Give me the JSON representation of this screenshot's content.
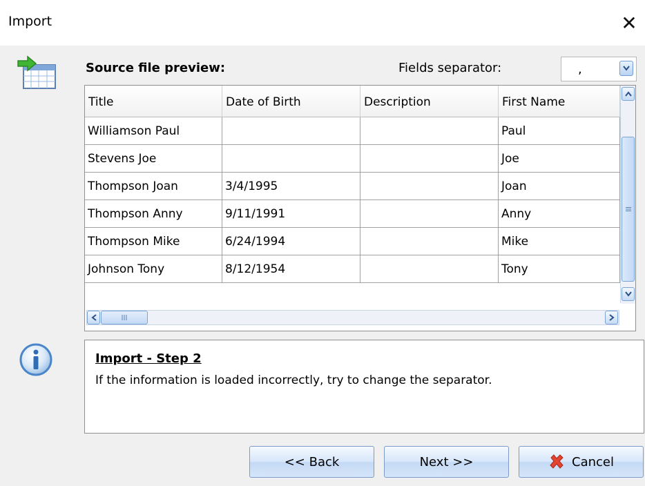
{
  "window": {
    "title": "Import",
    "close_glyph": "✕"
  },
  "header": {
    "preview_label": "Source file preview:",
    "separator_label": "Fields separator:",
    "separator_value": ","
  },
  "grid": {
    "columns": [
      "Title",
      "Date of Birth",
      "Description",
      "First Name"
    ],
    "rows": [
      [
        "Williamson Paul",
        "",
        "",
        "Paul"
      ],
      [
        "Stevens Joe",
        "",
        "",
        "Joe"
      ],
      [
        "Thompson Joan",
        "3/4/1995",
        "",
        "Joan"
      ],
      [
        "Thompson Anny",
        "9/11/1991",
        "",
        "Anny"
      ],
      [
        "Thompson Mike",
        "6/24/1994",
        "",
        "Mike"
      ],
      [
        "Johnson Tony",
        "8/12/1954",
        "",
        "Tony"
      ]
    ]
  },
  "info": {
    "title": "Import - Step 2",
    "text": "If the information is loaded incorrectly, try to change the separator."
  },
  "buttons": {
    "back": "<< Back",
    "next": "Next >>",
    "cancel": "Cancel"
  },
  "icons": {
    "import": "import-table-icon",
    "info": "info-icon",
    "cancel": "cancel-x-icon"
  },
  "colors": {
    "accent": "#3d7cc9",
    "scroll": "#c3d9f5",
    "cancel_red": "#e2452f"
  }
}
